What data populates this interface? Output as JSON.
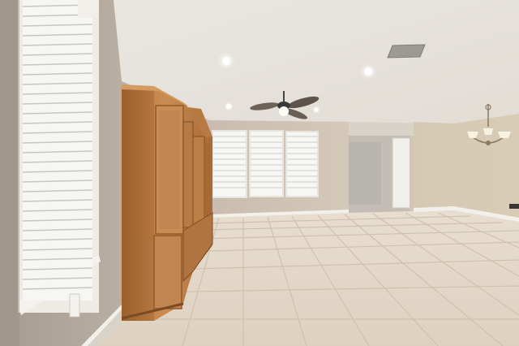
{
  "scene": {
    "description_colors": {
      "ceiling": "#e6e2dc",
      "wall_left": "#b9aea2",
      "wall_back": "#cfc3b5",
      "wall_right": "#d8ccb8",
      "floor": "#e3d8c8",
      "grout": "#cbbfae",
      "wood": "#c0834a",
      "wood_dark": "#8d5727",
      "blind": "#f4f4f2",
      "baseboard": "#f2efe9"
    }
  }
}
